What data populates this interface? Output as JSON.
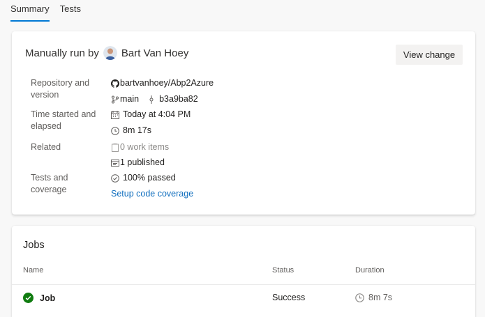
{
  "tabs": [
    {
      "label": "Summary"
    },
    {
      "label": "Tests"
    }
  ],
  "summary": {
    "run_prefix": "Manually run by",
    "user_name": "Bart Van Hoey",
    "view_change_label": "View change",
    "repo_label": "Repository and version",
    "repo_name": "bartvanhoey/Abp2Azure",
    "branch": "main",
    "commit": "b3a9ba82",
    "time_label": "Time started and elapsed",
    "time_started": "Today at 4:04 PM",
    "elapsed": "8m 17s",
    "related_label": "Related",
    "work_items": "0 work items",
    "published": "1 published",
    "tests_label": "Tests and coverage",
    "tests_passed": "100% passed",
    "coverage_link": "Setup code coverage"
  },
  "jobs": {
    "title": "Jobs",
    "columns": {
      "name": "Name",
      "status": "Status",
      "duration": "Duration"
    },
    "rows": [
      {
        "name": "Job",
        "status": "Success",
        "duration": "8m 7s"
      }
    ]
  },
  "colors": {
    "accent": "#0078d4",
    "success": "#107c10",
    "link": "#106ebe"
  },
  "icons": [
    "github-icon",
    "branch-icon",
    "commit-icon",
    "calendar-icon",
    "clock-icon",
    "work-item-icon",
    "artifact-icon",
    "check-circle-icon",
    "success-icon"
  ]
}
